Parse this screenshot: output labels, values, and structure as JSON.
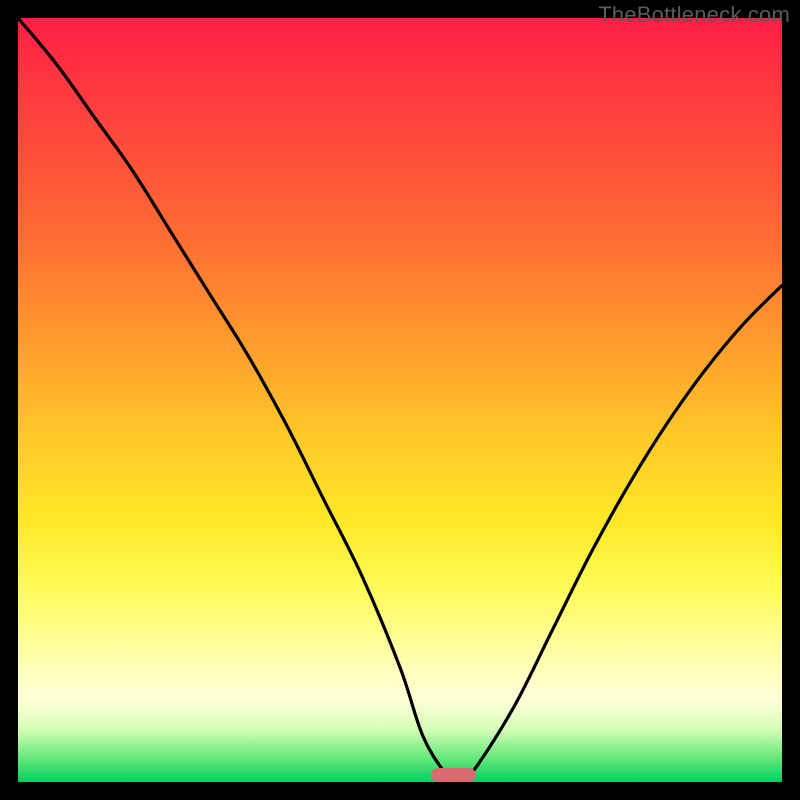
{
  "attribution": "TheBottleneck.com",
  "colors": {
    "frame": "#000000",
    "gradient_top": "#ff1f44",
    "gradient_mid1": "#ff9a2d",
    "gradient_mid2": "#ffe927",
    "gradient_bottom": "#00d060",
    "curve": "#000000",
    "marker": "#d96a6f"
  },
  "chart_data": {
    "type": "line",
    "title": "",
    "xlabel": "",
    "ylabel": "",
    "xlim": [
      0,
      100
    ],
    "ylim": [
      0,
      100
    ],
    "x": [
      0,
      5,
      10,
      15,
      20,
      25,
      30,
      35,
      40,
      45,
      50,
      53,
      56,
      57,
      58,
      60,
      65,
      70,
      75,
      80,
      85,
      90,
      95,
      100
    ],
    "values": [
      100,
      94,
      87,
      80,
      72,
      64,
      56,
      47,
      37,
      27,
      15,
      6,
      1,
      0,
      0,
      2,
      10,
      20,
      30,
      39,
      47,
      54,
      60,
      65
    ],
    "series": [
      {
        "name": "bottleneck-curve",
        "values": [
          100,
          94,
          87,
          80,
          72,
          64,
          56,
          47,
          37,
          27,
          15,
          6,
          1,
          0,
          0,
          2,
          10,
          20,
          30,
          39,
          47,
          54,
          60,
          65
        ]
      }
    ],
    "minimum_x": 57,
    "marker": {
      "x_center": 57,
      "y": 0,
      "width_pct": 6
    }
  }
}
